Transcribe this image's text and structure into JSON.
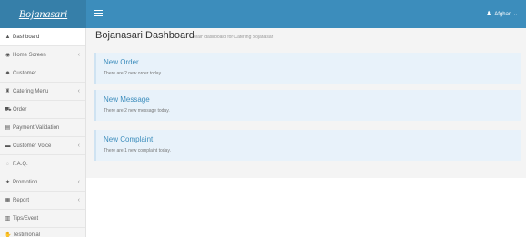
{
  "app": {
    "brand": "Bojanasari"
  },
  "topbar": {
    "user_label": "Afghan",
    "user_caret": "⌄"
  },
  "sidebar": {
    "items": [
      {
        "label": "Dashboard",
        "icon": "▲",
        "icon_name": "dashboard-icon",
        "expandable": false
      },
      {
        "label": "Home Screen",
        "icon": "◉",
        "icon_name": "eye-icon",
        "expandable": true
      },
      {
        "label": "Customer",
        "icon": "☻",
        "icon_name": "users-icon",
        "expandable": false
      },
      {
        "label": "Catering Menu",
        "icon": "♜",
        "icon_name": "cutlery-icon",
        "expandable": true
      },
      {
        "label": "Order",
        "icon": "⛟",
        "icon_name": "cart-icon",
        "expandable": false
      },
      {
        "label": "Payment Validation",
        "icon": "▤",
        "icon_name": "credit-card-icon",
        "expandable": false
      },
      {
        "label": "Customer Voice",
        "icon": "▬",
        "icon_name": "envelope-icon",
        "expandable": true
      },
      {
        "label": "F.A.Q.",
        "icon": "◌",
        "icon_name": "comment-icon",
        "expandable": false
      },
      {
        "label": "Promotion",
        "icon": "✦",
        "icon_name": "bullhorn-icon",
        "expandable": true
      },
      {
        "label": "Report",
        "icon": "▦",
        "icon_name": "chart-icon",
        "expandable": true
      },
      {
        "label": "Tips/Event",
        "icon": "▥",
        "icon_name": "list-icon",
        "expandable": false
      },
      {
        "label": "Testimonial",
        "icon": "✋",
        "icon_name": "thumbs-up-icon",
        "expandable": false
      }
    ],
    "caret": "‹"
  },
  "page": {
    "title": "Bojanasari Dashboard",
    "subtitle": "Main dashboard for Catering Bojanasari"
  },
  "callouts": [
    {
      "title": "New Order",
      "desc": "There are 2 new order today."
    },
    {
      "title": "New Message",
      "desc": "There are 2 new message today."
    },
    {
      "title": "New Complaint",
      "desc": "There are 1 new complaint today."
    }
  ],
  "colors": {
    "primary": "#3c8dbc",
    "brand_bg": "#367fa9",
    "callout_bg": "#e8f2fa"
  }
}
